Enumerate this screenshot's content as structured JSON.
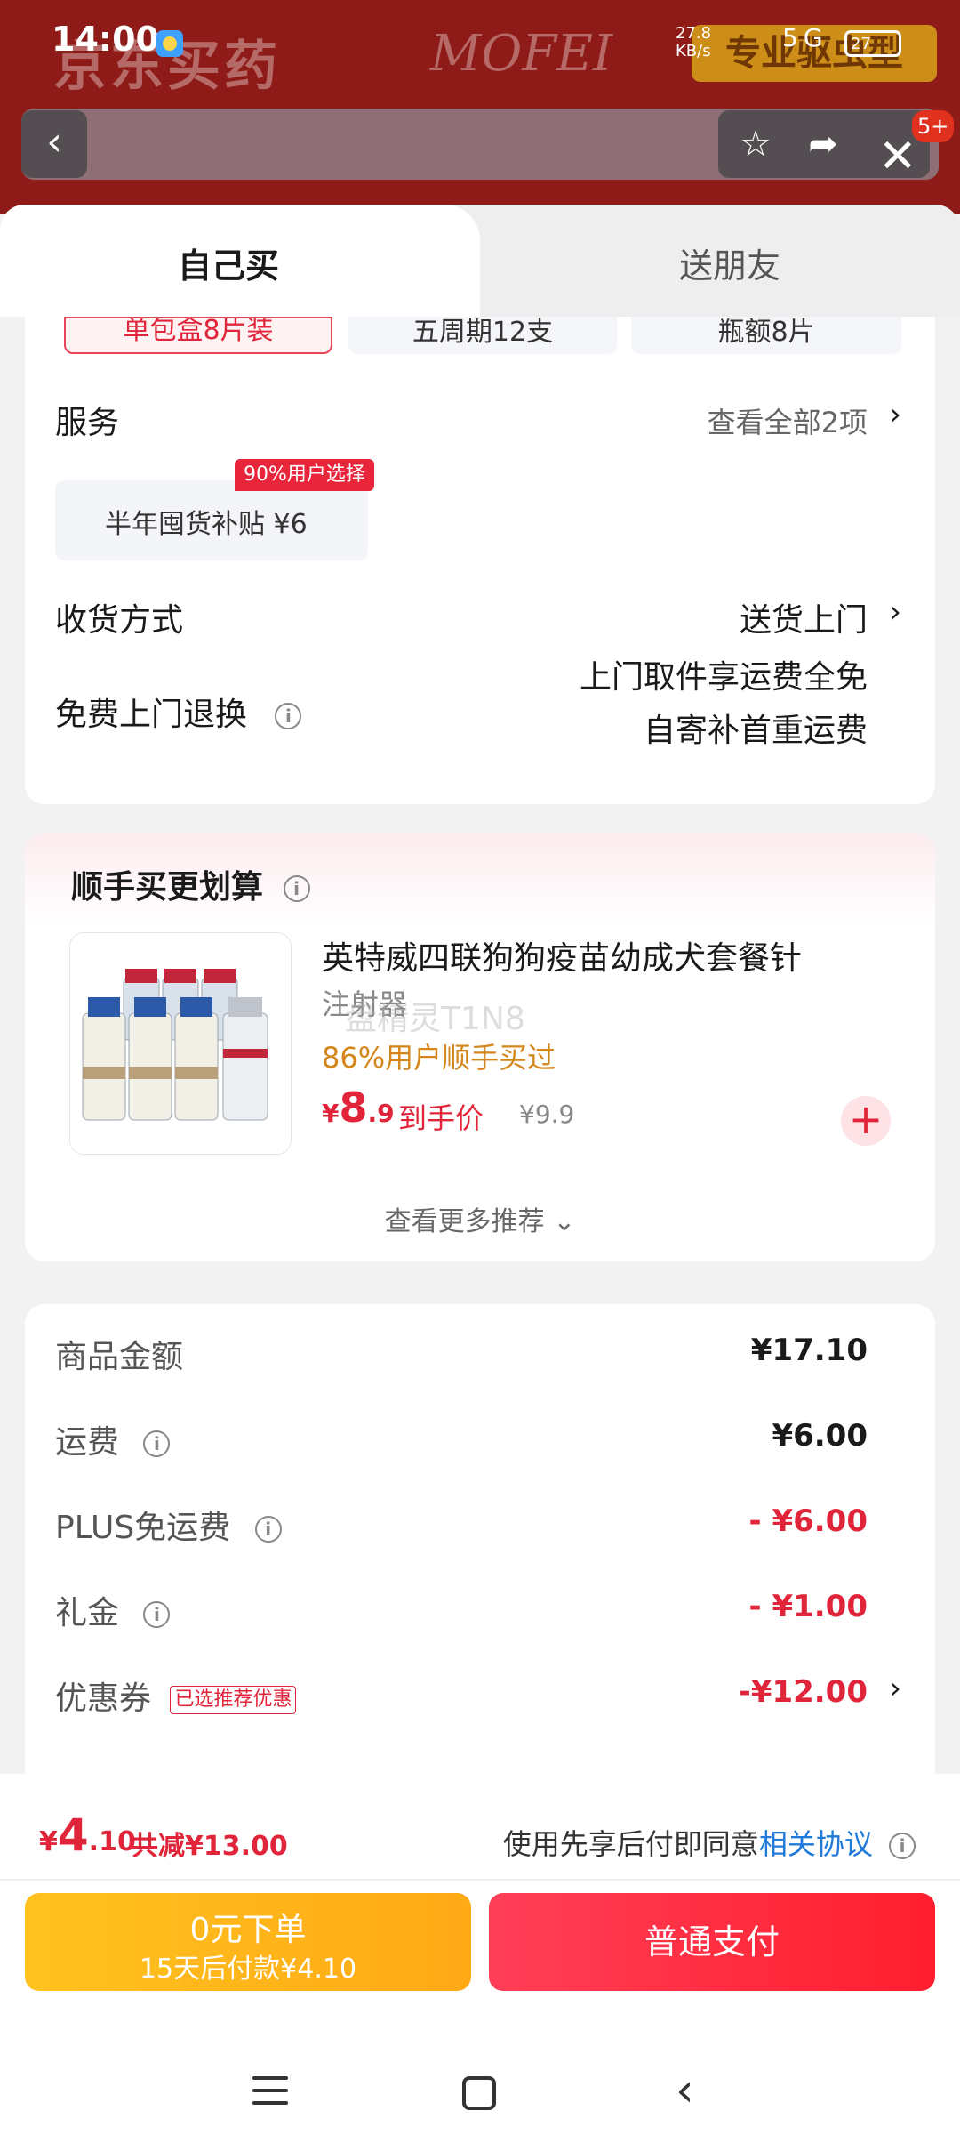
{
  "status_bar": {
    "time": "14:00",
    "net_speed_top": "27.8",
    "net_speed_bottom": "KB/s",
    "network": "5G",
    "battery": "27"
  },
  "background": {
    "brand": "京东买药",
    "banner_text": "MOFEI",
    "pill_text": "专业驱虫型"
  },
  "nav": {
    "badge": "5+"
  },
  "tabs": {
    "self": "自己买",
    "friend": "送朋友"
  },
  "spec": {
    "options": [
      "单包盒8片装",
      "五周期12支",
      "瓶额8片"
    ]
  },
  "service": {
    "label": "服务",
    "view_all": "查看全部2项",
    "item": "半年囤货补贴  ¥6",
    "item_tag": "90%用户选择"
  },
  "delivery": {
    "label": "收货方式",
    "value": "送货上门"
  },
  "return": {
    "label": "免费上门退换",
    "line1": "上门取件享运费全免",
    "line2": "自寄补首重运费"
  },
  "recommend": {
    "title": "顺手买更划算",
    "product_name": "英特威四联狗狗疫苗幼成犬套餐针",
    "product_name2": "注射器",
    "watermark": "盘精灵T1N8",
    "buyers": "86%用户顺手买过",
    "price_symbol": "¥",
    "price_int": "8",
    "price_dec": ".9",
    "price_tag": "到手价",
    "orig_price": "¥9.9",
    "more": "查看更多推荐"
  },
  "summary": {
    "goods_label": "商品金额",
    "goods_value": "¥17.10",
    "ship_label": "运费",
    "ship_value": "¥6.00",
    "plus_label": "PLUS免运费",
    "plus_value": "- ¥6.00",
    "gift_label": "礼金",
    "gift_value": "- ¥1.00",
    "coupon_label": "优惠券",
    "coupon_tag": "已选推荐优惠",
    "coupon_value": "-¥12.00"
  },
  "bottom": {
    "price_symbol": "¥",
    "price_int": "4",
    "price_dec": ".10",
    "reduce": "共减¥13.00",
    "agree_text": "使用先享后付即同意",
    "agree_link": "相关协议",
    "later_line1": "0元下单",
    "later_line2": "15天后付款¥4.10",
    "pay": "普通支付"
  },
  "colors": {
    "accent_red": "#e0253b",
    "link_blue": "#1f7ad9",
    "later_yellow": "#ffb41a",
    "header_bg": "#8e1b17"
  }
}
